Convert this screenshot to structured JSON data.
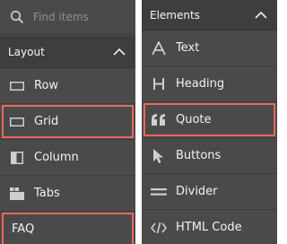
{
  "left_panel": {
    "search": {
      "placeholder": "Find items",
      "value": ""
    },
    "section": {
      "label": "Layout"
    },
    "items": [
      {
        "label": "Row",
        "icon": "row-icon"
      },
      {
        "label": "Grid",
        "icon": "grid-icon",
        "highlighted": true
      },
      {
        "label": "Column",
        "icon": "column-icon"
      },
      {
        "label": "Tabs",
        "icon": "tabs-icon"
      },
      {
        "label": "FAQ",
        "icon": "",
        "highlighted": true
      }
    ]
  },
  "right_panel": {
    "section": {
      "label": "Elements"
    },
    "items": [
      {
        "label": "Text",
        "icon": "text-icon"
      },
      {
        "label": "Heading",
        "icon": "heading-icon"
      },
      {
        "label": "Quote",
        "icon": "quote-icon",
        "highlighted": true
      },
      {
        "label": "Buttons",
        "icon": "cursor-icon"
      },
      {
        "label": "Divider",
        "icon": "divider-icon"
      },
      {
        "label": "HTML Code",
        "icon": "code-icon"
      }
    ]
  },
  "colors": {
    "panel_bg": "#4a4a4a",
    "header_bg": "#3e3e3e",
    "highlight": "#e8685d",
    "text": "#f2f2f2"
  }
}
